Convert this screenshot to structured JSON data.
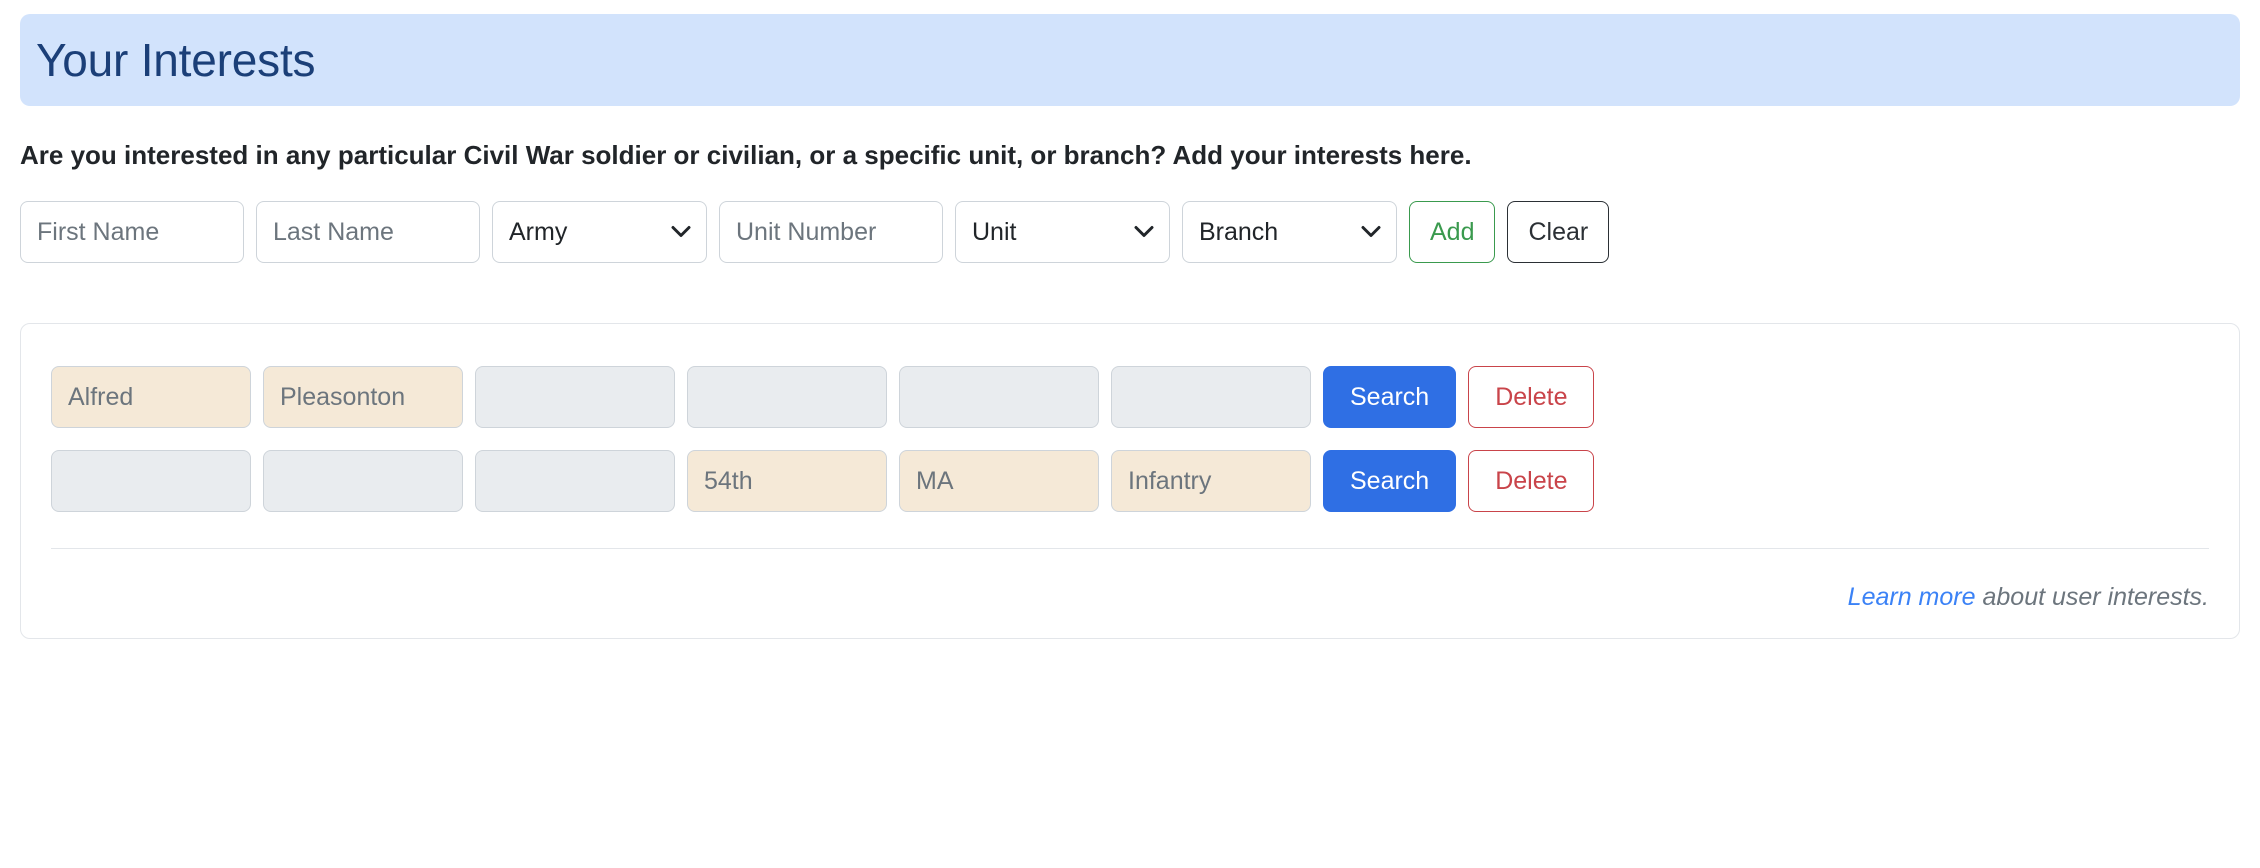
{
  "banner": {
    "title": "Your Interests"
  },
  "description": "Are you interested in any particular Civil War soldier or civilian, or a specific unit, or branch? Add your interests here.",
  "form": {
    "first_name": {
      "placeholder": "First Name",
      "value": ""
    },
    "last_name": {
      "placeholder": "Last Name",
      "value": ""
    },
    "army": {
      "selected": "Army",
      "options": [
        "Army"
      ]
    },
    "unit_number": {
      "placeholder": "Unit Number",
      "value": ""
    },
    "unit": {
      "selected": "Unit",
      "options": [
        "Unit"
      ]
    },
    "branch": {
      "selected": "Branch",
      "options": [
        "Branch"
      ]
    },
    "add_label": "Add",
    "clear_label": "Clear"
  },
  "interests": {
    "rows": [
      {
        "first_name": "Alfred",
        "last_name": "Pleasonton",
        "army": "",
        "unit_number": "",
        "unit": "",
        "branch": "",
        "search_label": "Search",
        "delete_label": "Delete"
      },
      {
        "first_name": "",
        "last_name": "",
        "army": "",
        "unit_number": "54th",
        "unit": "MA",
        "branch": "Infantry",
        "search_label": "Search",
        "delete_label": "Delete"
      }
    ],
    "footer": {
      "link_text": "Learn more",
      "trailing_text": " about user interests."
    }
  },
  "colors": {
    "banner_bg": "#d2e3fc",
    "banner_text": "#1b3f78",
    "add_accent": "#3a9a4e",
    "search_accent": "#2f6fe4",
    "delete_accent": "#c9444a",
    "filled_cell_bg": "#f5e9d7",
    "empty_cell_bg": "#e9ecef",
    "link": "#3b82f6"
  }
}
